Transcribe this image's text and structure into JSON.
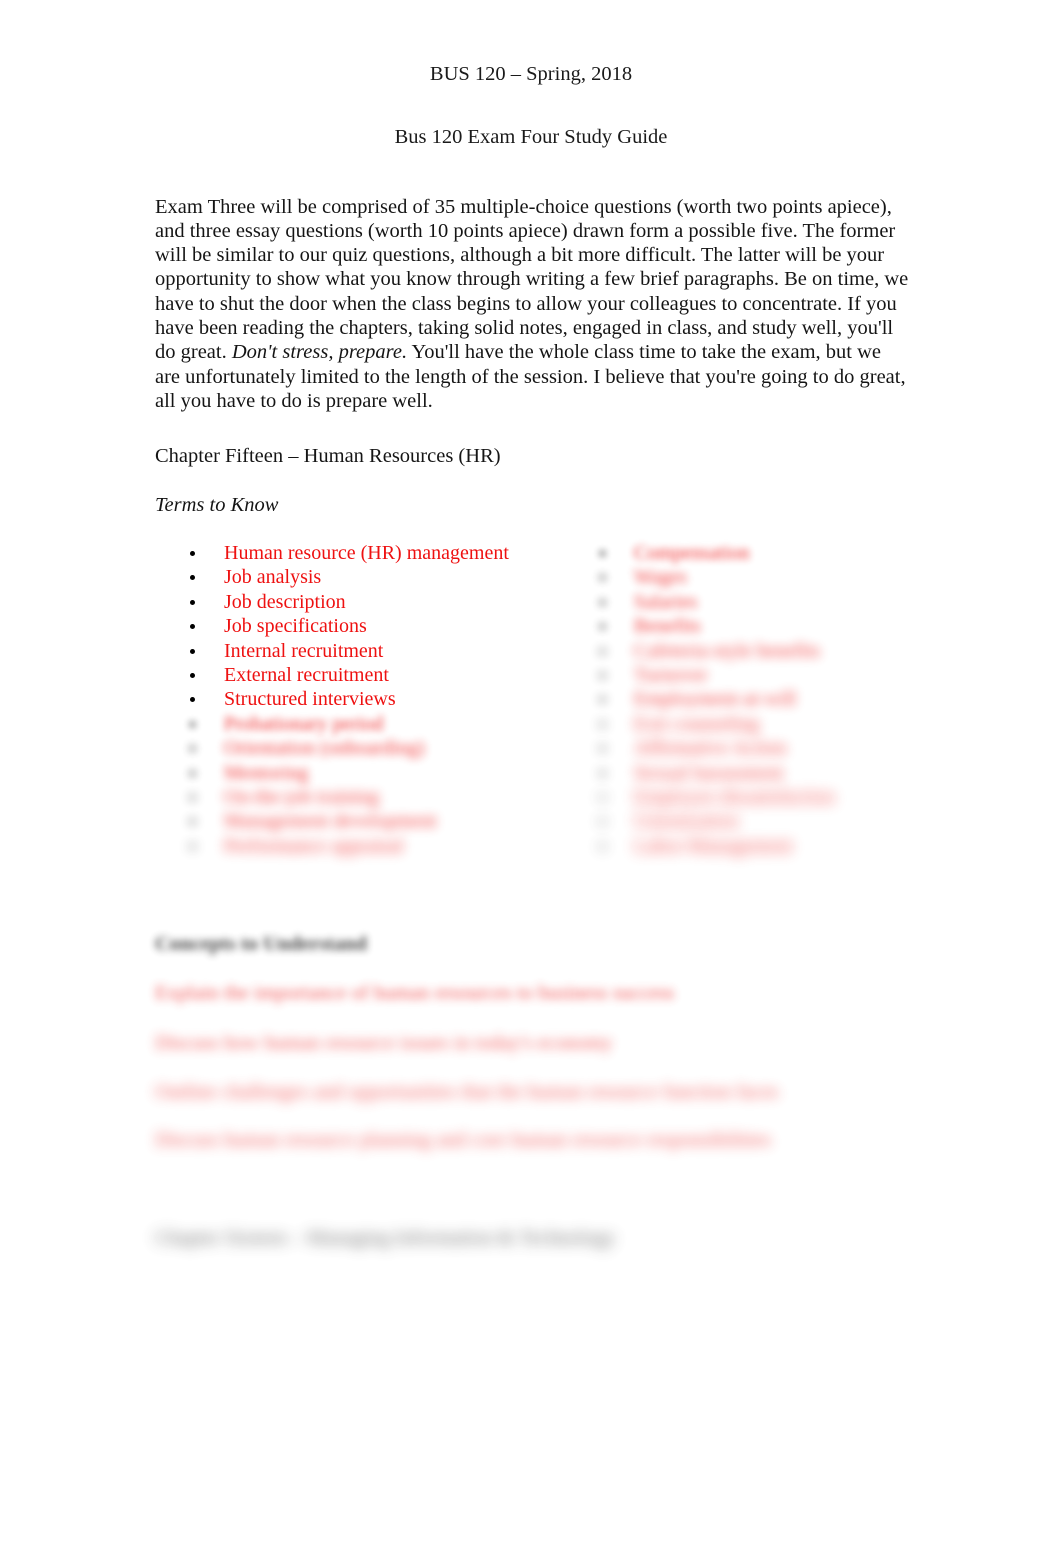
{
  "document": {
    "course_header": "BUS 120 – Spring, 2018",
    "title": "Bus 120 Exam Four Study Guide",
    "intro_part1": "Exam Three will be comprised of 35 multiple-choice questions (worth two points apiece), and three essay questions (worth 10 points apiece) drawn form a possible five.  The former will be similar to our quiz questions, although a bit more difficult.  The latter will be your opportunity to show what you know through writing a few brief paragraphs.  Be on time, we have to shut the door when the class begins to allow your colleagues to concentrate.  If you have been reading the chapters, taking solid notes, engaged in class, and study well, you'll do great.  ",
    "intro_emphasis": "Don't stress, prepare.",
    "intro_part2": "  You'll have the whole class time to take the exam, but we are unfortunately limited to the length of the session.  I believe that you're going to do great, all you have to do is prepare well.",
    "chapter_fifteen_heading": "Chapter Fifteen – Human Resources (HR)",
    "terms_to_know_label": "Terms to Know"
  },
  "terms": {
    "left_column": [
      {
        "text": "Human resource (HR) management",
        "blur": "b0"
      },
      {
        "text": "Job analysis",
        "blur": "b0"
      },
      {
        "text": "Job description",
        "blur": "b0"
      },
      {
        "text": "Job specifications",
        "blur": "b0"
      },
      {
        "text": "Internal recruitment",
        "blur": "b0"
      },
      {
        "text": "External recruitment",
        "blur": "b0"
      },
      {
        "text": "Structured interviews",
        "blur": "b0"
      },
      {
        "text": "Probationary period",
        "blur": "b2"
      },
      {
        "text": "Orientation (onboarding)",
        "blur": "b3"
      },
      {
        "text": "Mentoring",
        "blur": "b3"
      },
      {
        "text": "On-the-job training",
        "blur": "b4"
      },
      {
        "text": "Management development",
        "blur": "b4"
      },
      {
        "text": "Performance appraisal",
        "blur": "b5"
      }
    ],
    "right_column": [
      {
        "text": "Compensation",
        "blur": "b2"
      },
      {
        "text": "Wages",
        "blur": "b3"
      },
      {
        "text": "Salaries",
        "blur": "b3"
      },
      {
        "text": "Benefits",
        "blur": "b3"
      },
      {
        "text": "Cafeteria-style benefits",
        "blur": "b4"
      },
      {
        "text": "Turnover",
        "blur": "b4"
      },
      {
        "text": "Employment-at-will",
        "blur": "b4"
      },
      {
        "text": "Exit counseling",
        "blur": "b5"
      },
      {
        "text": "Affirmative Action",
        "blur": "b5"
      },
      {
        "text": "Sexual harassment",
        "blur": "b5"
      },
      {
        "text": "Employee dissatisfaction",
        "blur": "b6"
      },
      {
        "text": "Unionization",
        "blur": "b6"
      },
      {
        "text": "Labor-Management",
        "blur": "b6"
      }
    ]
  },
  "concepts_section": {
    "heading": "Concepts to Understand",
    "lines": [
      "Explain the importance of human resources to business success",
      "Discuss how human resource issues in today's economy",
      "Outline challenges and opportunities that the human resource function faces",
      "Discuss human resource planning and core human resource responsibilities"
    ]
  },
  "chapter_sixteen": {
    "heading": "Chapter Sixteen – Managing Information & Technology"
  },
  "colors": {
    "term_red": "#ee1111",
    "body_black": "#151515",
    "page_background": "#ffffff"
  }
}
